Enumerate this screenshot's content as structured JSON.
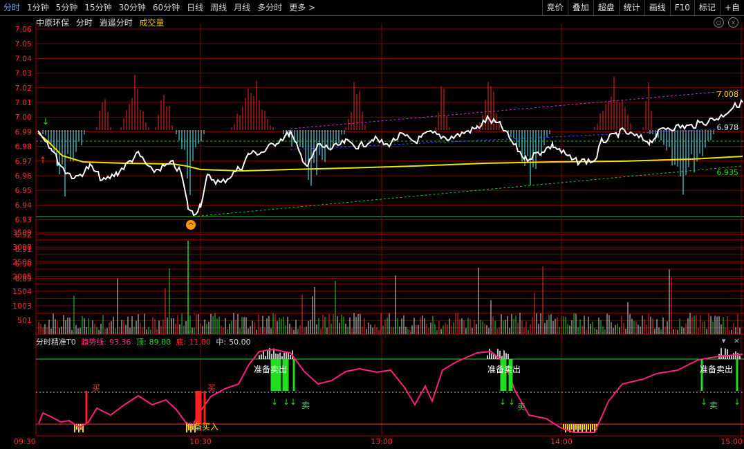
{
  "toolbar": {
    "periods": [
      "分时",
      "1分钟",
      "5分钟",
      "15分钟",
      "30分钟",
      "60分钟",
      "日线",
      "周线",
      "月线",
      "多分时",
      "更多"
    ],
    "more_chevron": "chevron-right-icon",
    "buttons": [
      "竞价",
      "叠加",
      "超盘",
      "统计",
      "画线",
      "F10",
      "标记",
      "+自"
    ]
  },
  "header": {
    "stock_name": "中原环保",
    "mode": "分时",
    "formula": "逍遥分时",
    "volume_label": "成交量"
  },
  "price_axis": {
    "labels": [
      "7.06",
      "7.05",
      "7.04",
      "7.03",
      "7.02",
      "7.01",
      "7.00",
      "6.99",
      "6.98",
      "6.97",
      "6.96",
      "6.95",
      "6.94",
      "6.93",
      "6.92",
      "6.91",
      "6.90",
      "6.89"
    ]
  },
  "volume_axis": {
    "labels": [
      "3509",
      "3008",
      "2506",
      "2005",
      "1504",
      "1003",
      "501"
    ]
  },
  "annotations": {
    "upper_right_top": "7.008",
    "upper_right_mid": "6.978",
    "upper_right_low": "6.935"
  },
  "indicator": {
    "name": "分时精准T0",
    "trend_label": "趋势线:",
    "trend_value": "93.36",
    "top_label": "顶:",
    "top_value": "89.00",
    "bottom_label": "底:",
    "bottom_value": "11.00",
    "mid_label": "中:",
    "mid_value": "50.00",
    "signals": {
      "buy": "买",
      "prepare_buy": "准备买入",
      "prepare_sell": "准备卖出",
      "sell": "卖"
    }
  },
  "time_axis": {
    "labels": [
      "09:30",
      "10:30",
      "13:00",
      "14:00",
      "15:00"
    ]
  },
  "colors": {
    "grid": "#8b0000",
    "price_line": "#ffffff",
    "avg_line": "#e8e800",
    "cyan_bars": "#4fd6e0",
    "red_bars": "#d02020",
    "trend_line": "#ff2080",
    "green": "#22dd22",
    "yellow": "#ffd700"
  }
}
